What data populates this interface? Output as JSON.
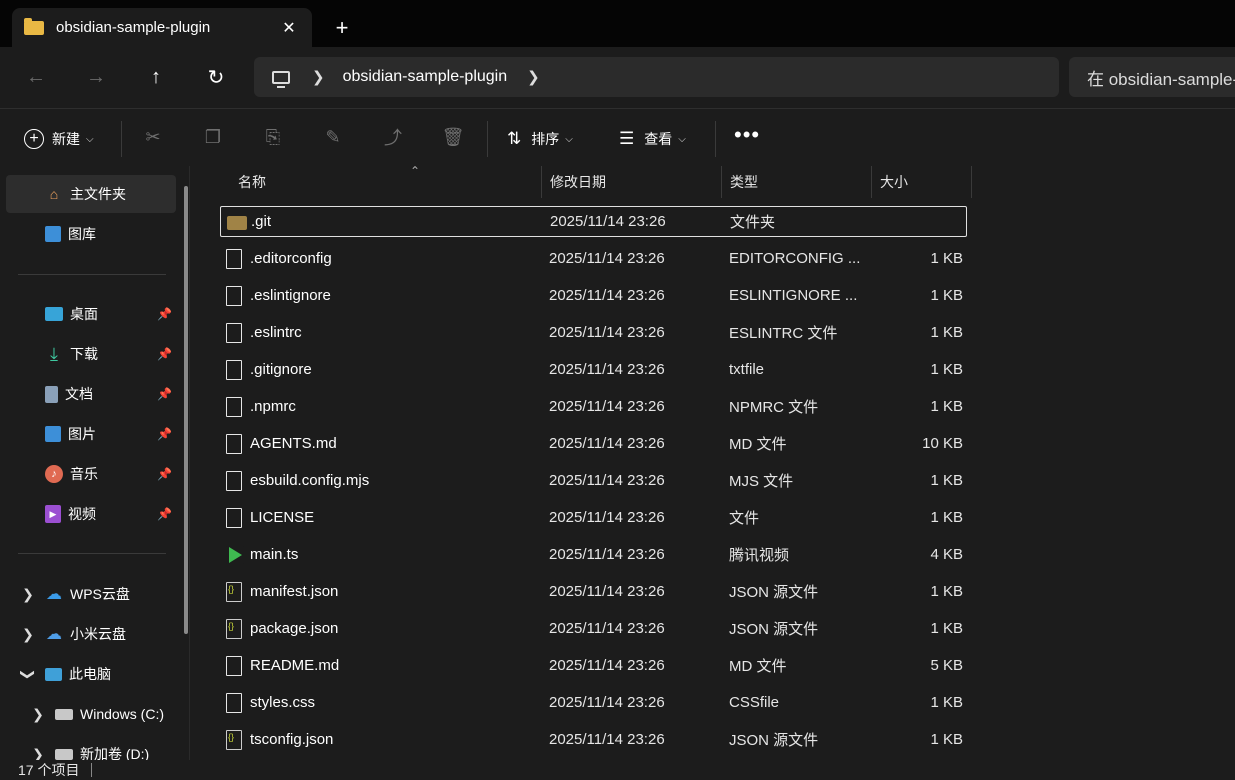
{
  "tab": {
    "title": "obsidian-sample-plugin",
    "close": "✕",
    "new_tab": "+"
  },
  "nav": {
    "back": "←",
    "forward": "→",
    "up": "↑",
    "refresh": "↻",
    "breadcrumb": "obsidian-sample-plugin",
    "search_placeholder": "在 obsidian-sample-plugin 中搜索"
  },
  "commands": {
    "new_label": "新建",
    "sort_label": "排序",
    "view_label": "查看",
    "more_label": "•••",
    "icons": [
      "cut-icon",
      "copy-icon",
      "paste-icon",
      "rename-icon",
      "share-icon",
      "delete-icon"
    ]
  },
  "sidebar": {
    "home": "主文件夹",
    "gallery": "图库",
    "quick": [
      {
        "label": "桌面",
        "icon": "desktop-icon"
      },
      {
        "label": "下载",
        "icon": "download-icon"
      },
      {
        "label": "文档",
        "icon": "document-icon"
      },
      {
        "label": "图片",
        "icon": "pictures-icon"
      },
      {
        "label": "音乐",
        "icon": "music-icon"
      },
      {
        "label": "视频",
        "icon": "video-icon"
      }
    ],
    "wps": "WPS云盘",
    "mi": "小米云盘",
    "pc": "此电脑",
    "drive_c": "Windows (C:)",
    "drive_d": "新加卷 (D:)"
  },
  "columns": {
    "name": "名称",
    "date": "修改日期",
    "type": "类型",
    "size": "大小"
  },
  "files": [
    {
      "name": ".git",
      "date": "2025/11/14 23:26",
      "type": "文件夹",
      "size": "",
      "kind": "folder"
    },
    {
      "name": ".editorconfig",
      "date": "2025/11/14 23:26",
      "type": "EDITORCONFIG ...",
      "size": "1 KB",
      "kind": "file"
    },
    {
      "name": ".eslintignore",
      "date": "2025/11/14 23:26",
      "type": "ESLINTIGNORE ...",
      "size": "1 KB",
      "kind": "file"
    },
    {
      "name": ".eslintrc",
      "date": "2025/11/14 23:26",
      "type": "ESLINTRC 文件",
      "size": "1 KB",
      "kind": "file"
    },
    {
      "name": ".gitignore",
      "date": "2025/11/14 23:26",
      "type": "txtfile",
      "size": "1 KB",
      "kind": "file"
    },
    {
      "name": ".npmrc",
      "date": "2025/11/14 23:26",
      "type": "NPMRC 文件",
      "size": "1 KB",
      "kind": "file"
    },
    {
      "name": "AGENTS.md",
      "date": "2025/11/14 23:26",
      "type": "MD 文件",
      "size": "10 KB",
      "kind": "file"
    },
    {
      "name": "esbuild.config.mjs",
      "date": "2025/11/14 23:26",
      "type": "MJS 文件",
      "size": "1 KB",
      "kind": "file"
    },
    {
      "name": "LICENSE",
      "date": "2025/11/14 23:26",
      "type": "文件",
      "size": "1 KB",
      "kind": "file"
    },
    {
      "name": "main.ts",
      "date": "2025/11/14 23:26",
      "type": "腾讯视频",
      "size": "4 KB",
      "kind": "video"
    },
    {
      "name": "manifest.json",
      "date": "2025/11/14 23:26",
      "type": "JSON 源文件",
      "size": "1 KB",
      "kind": "json"
    },
    {
      "name": "package.json",
      "date": "2025/11/14 23:26",
      "type": "JSON 源文件",
      "size": "1 KB",
      "kind": "json"
    },
    {
      "name": "README.md",
      "date": "2025/11/14 23:26",
      "type": "MD 文件",
      "size": "5 KB",
      "kind": "file"
    },
    {
      "name": "styles.css",
      "date": "2025/11/14 23:26",
      "type": "CSSfile",
      "size": "1 KB",
      "kind": "file"
    },
    {
      "name": "tsconfig.json",
      "date": "2025/11/14 23:26",
      "type": "JSON 源文件",
      "size": "1 KB",
      "kind": "json"
    }
  ],
  "status": {
    "count": "17 个项目"
  }
}
